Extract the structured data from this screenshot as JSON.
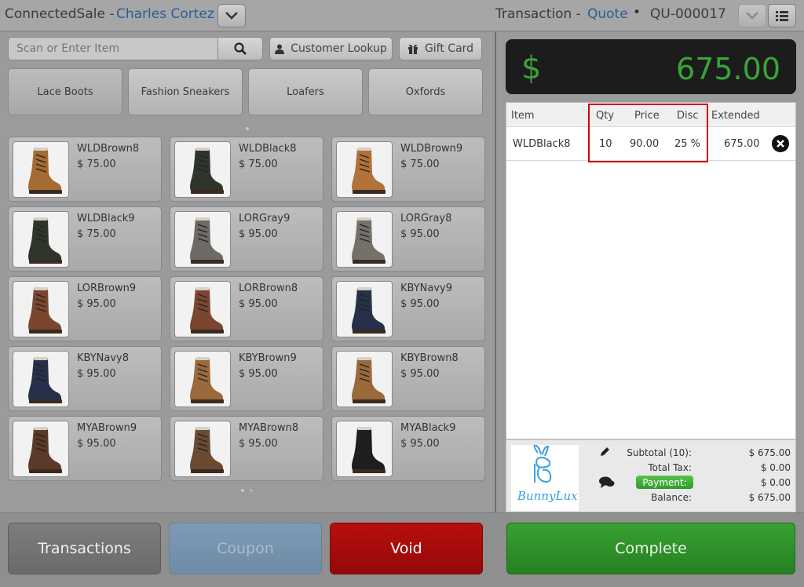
{
  "header": {
    "app_name": "ConnectedSale -",
    "user_name": "Charles Cortez",
    "transaction_label": "Transaction -",
    "transaction_type": "Quote",
    "separator": "•",
    "quote_number": "QU-000017"
  },
  "toolbar": {
    "search_placeholder": "Scan or Enter Item",
    "customer_lookup_label": "Customer Lookup",
    "gift_card_label": "Gift Card"
  },
  "categories": [
    {
      "label": "Lace Boots",
      "active": true
    },
    {
      "label": "Fashion Sneakers",
      "active": false
    },
    {
      "label": "Loafers",
      "active": false
    },
    {
      "label": "Oxfords",
      "active": false
    }
  ],
  "products": [
    {
      "name": "WLDBrown8",
      "price": "$ 75.00",
      "color": "#a56b32"
    },
    {
      "name": "WLDBlack8",
      "price": "$ 75.00",
      "color": "#2f352b"
    },
    {
      "name": "WLDBrown9",
      "price": "$ 75.00",
      "color": "#b07238"
    },
    {
      "name": "WLDBlack9",
      "price": "$ 75.00",
      "color": "#2f352b"
    },
    {
      "name": "LORGray9",
      "price": "$ 95.00",
      "color": "#6e6a66"
    },
    {
      "name": "LORGray8",
      "price": "$ 95.00",
      "color": "#757068"
    },
    {
      "name": "LORBrown9",
      "price": "$ 95.00",
      "color": "#7a4630"
    },
    {
      "name": "LORBrown8",
      "price": "$ 95.00",
      "color": "#7a4630"
    },
    {
      "name": "KBYNavy9",
      "price": "$ 95.00",
      "color": "#26304a"
    },
    {
      "name": "KBYNavy8",
      "price": "$ 95.00",
      "color": "#26304a"
    },
    {
      "name": "KBYBrown9",
      "price": "$ 95.00",
      "color": "#9a6a3c"
    },
    {
      "name": "KBYBrown8",
      "price": "$ 95.00",
      "color": "#9a6a3c"
    },
    {
      "name": "MYABrown9",
      "price": "$ 95.00",
      "color": "#5b3a2a"
    },
    {
      "name": "MYABrown8",
      "price": "$ 95.00",
      "color": "#6b4a32"
    },
    {
      "name": "MYABlack9",
      "price": "$ 95.00",
      "color": "#1e1e1e"
    }
  ],
  "total": {
    "symbol": "$",
    "amount": "675.00"
  },
  "grid": {
    "headers": {
      "item": "Item",
      "qty": "Qty",
      "price": "Price",
      "disc": "Disc",
      "extended": "Extended"
    },
    "rows": [
      {
        "item": "WLDBlack8",
        "qty": "10",
        "price": "90.00",
        "disc": "25 %",
        "extended": "675.00"
      }
    ]
  },
  "summary": {
    "logo_text": "BunnyLux",
    "subtotal_label": "Subtotal (10):",
    "subtotal_value": "$ 675.00",
    "tax_label": "Total Tax:",
    "tax_value": "$ 0.00",
    "payment_label": "Payment:",
    "payment_value": "$ 0.00",
    "balance_label": "Balance:",
    "balance_value": "$ 675.00"
  },
  "actions": {
    "transactions": "Transactions",
    "coupon": "Coupon",
    "void": "Void",
    "complete": "Complete"
  },
  "colors": {
    "accent_link": "#2b5d9a",
    "total_green": "#3aa33a",
    "void_red": "#a80c0c",
    "complete_green": "#2f8d2a",
    "highlight_red": "#d40000"
  }
}
